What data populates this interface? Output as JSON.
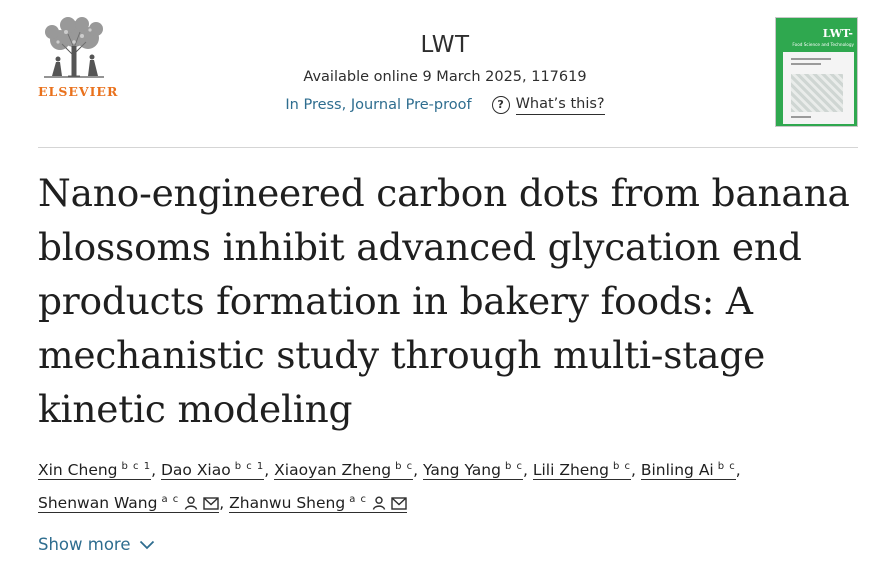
{
  "publisher": {
    "name": "ELSEVIER",
    "logo_icon": "elsevier-tree-icon"
  },
  "journal": {
    "name": "LWT"
  },
  "availability": "Available online 9 March 2025, 117619",
  "status": {
    "label": "In Press, Journal Pre-proof",
    "help_label": "What’s this?",
    "help_icon": "question-circle-icon"
  },
  "cover": {
    "title": "LWT-",
    "subtitle": "Food Science and Technology",
    "color": "#2fa84f"
  },
  "article": {
    "title": "Nano-engineered carbon dots from banana blossoms inhibit advanced glycation end products formation in bakery foods: A mechanistic study through multi-stage kinetic modeling"
  },
  "authors": [
    {
      "name": "Xin Cheng",
      "affil": "b c 1"
    },
    {
      "name": "Dao Xiao",
      "affil": "b c 1"
    },
    {
      "name": "Xiaoyan Zheng",
      "affil": "b c"
    },
    {
      "name": "Yang Yang",
      "affil": "b c"
    },
    {
      "name": "Lili Zheng",
      "affil": "b c"
    },
    {
      "name": "Binling Ai",
      "affil": "b c"
    },
    {
      "name": "Shenwan Wang",
      "affil": "a c",
      "icons": [
        "person-icon",
        "mail-icon"
      ]
    },
    {
      "name": "Zhanwu Sheng",
      "affil": "a c",
      "icons": [
        "person-icon",
        "mail-icon"
      ]
    }
  ],
  "show_more": {
    "label": "Show more",
    "icon": "chevron-down-icon"
  },
  "colors": {
    "link": "#2e6d8f",
    "brand": "#e9711c",
    "text": "#1f1f1f"
  }
}
